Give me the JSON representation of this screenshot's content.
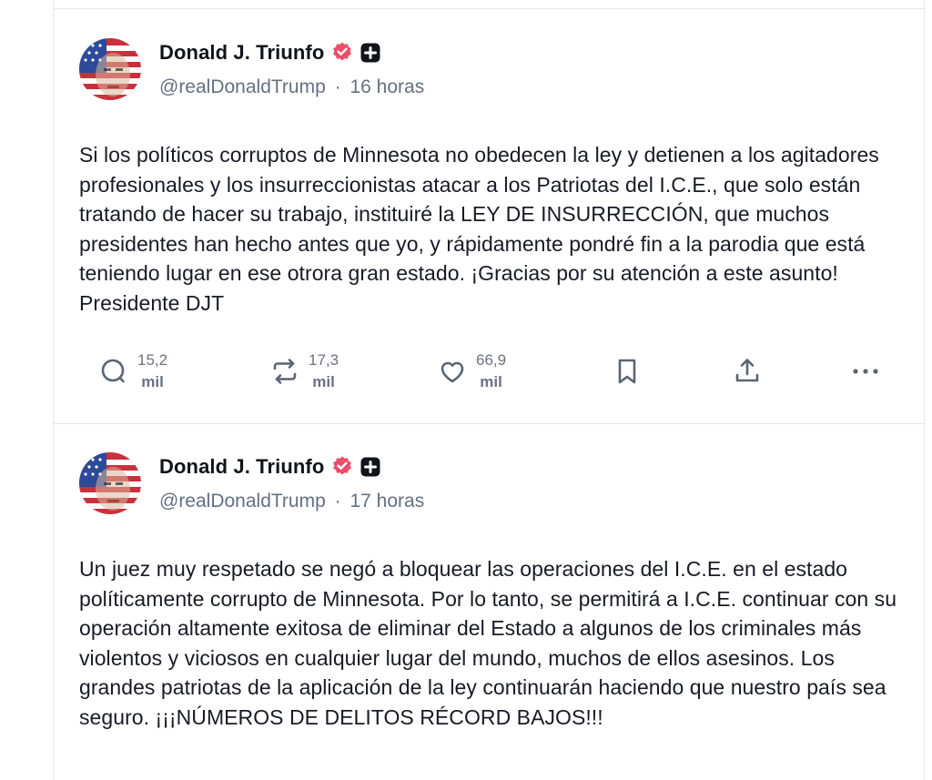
{
  "colors": {
    "verified": "#ec4d6a",
    "text": "#171b24",
    "muted": "#657080",
    "icon": "#5b6472"
  },
  "posts": [
    {
      "display_name": "Donald J. Triunfo",
      "handle": "@realDonaldTrump",
      "separator": "·",
      "time": "16 horas",
      "text": "Si los políticos corruptos de Minnesota no obedecen la ley y detienen a los agitadores profesionales y los insurreccionistas atacar a los Patriotas del I.C.E., que solo están tratando de hacer su trabajo, instituiré la LEY DE INSURRECCIÓN, que muchos presidentes han hecho antes que yo, y rápidamente pondré fin a la parodia que está teniendo lugar en ese otrora gran estado. ¡Gracias por su atención a este asunto! Presidente DJT",
      "actions": {
        "reply": {
          "icon": "reply-icon",
          "count": "15,2",
          "unit": "mil"
        },
        "retruth": {
          "icon": "repost-icon",
          "count": "17,3",
          "unit": "mil"
        },
        "like": {
          "icon": "heart-icon",
          "count": "66,9",
          "unit": "mil"
        },
        "bookmark": {
          "icon": "bookmark-icon"
        },
        "share": {
          "icon": "share-icon"
        },
        "more": {
          "icon": "more-icon"
        }
      }
    },
    {
      "display_name": "Donald J. Triunfo",
      "handle": "@realDonaldTrump",
      "separator": "·",
      "time": "17 horas",
      "text": "Un juez muy respetado se negó a bloquear las operaciones del I.C.E. en el estado políticamente corrupto de Minnesota. Por lo tanto, se permitirá a I.C.E. continuar con su operación altamente exitosa de eliminar del Estado a algunos de los criminales más violentos y viciosos en cualquier lugar del mundo, muchos de ellos asesinos. Los grandes patriotas de la aplicación de la ley continuarán haciendo que nuestro país sea seguro. ¡¡¡NÚMEROS DE DELITOS RÉCORD BAJOS!!!"
    }
  ]
}
